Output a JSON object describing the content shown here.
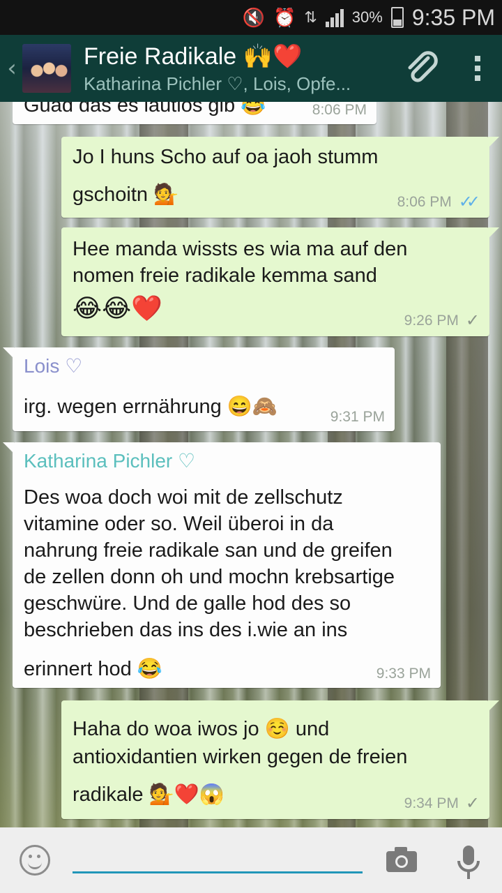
{
  "status_bar": {
    "battery_percent": "30%",
    "time": "9:35 PM",
    "icons": [
      "mute-icon",
      "alarm-icon",
      "data-arrows-icon",
      "signal-icon",
      "battery-icon"
    ]
  },
  "header": {
    "title": "Freie Radikale 🙌❤️",
    "subtitle": "Katharina Pichler ♡, Lois, Opfe...",
    "back_icon": "‹",
    "icons": [
      "back-icon",
      "group-avatar",
      "attach-icon",
      "overflow-menu-icon"
    ]
  },
  "messages": [
    {
      "direction": "in",
      "text": "Guad das es lautlos gib 😂",
      "time": "8:06 PM"
    },
    {
      "direction": "out",
      "line1": "Jo I huns Scho auf oa jaoh stumm",
      "line2": "gschoitn 💁",
      "time": "8:06 PM",
      "status": "read"
    },
    {
      "direction": "out",
      "line1": "Hee manda wissts es wia ma auf den",
      "line2": "nomen freie radikale kemma sand",
      "emojis": "😂😂❤️",
      "time": "9:26 PM",
      "status": "delivered"
    },
    {
      "direction": "in",
      "sender": "Lois ♡",
      "sender_color": "#8a90cc",
      "text": "irg. wegen errnährung 😄🙈",
      "time": "9:31 PM"
    },
    {
      "direction": "in",
      "sender": "Katharina Pichler ♡",
      "sender_color": "#5bbfbd",
      "lines": [
        "Des woa doch woi mit de zellschutz",
        "vitamine oder so. Weil überoi in da",
        "nahrung freie radikale san und de greifen",
        "de zellen donn oh und mochn krebsartige",
        "geschwüre. Und de galle hod des so",
        "beschrieben das ins des i.wie an ins",
        "erinnert hod 😂"
      ],
      "time": "9:33 PM"
    },
    {
      "direction": "out",
      "line1": "Haha do woa iwos jo ☺️ und",
      "line2": "antioxidantien wirken gegen de freien",
      "line3": "radikale 💁❤️😱",
      "time": "9:34 PM",
      "status": "delivered"
    }
  ],
  "input_bar": {
    "placeholder": "",
    "icons": [
      "emoji-icon",
      "camera-icon",
      "microphone-icon"
    ]
  },
  "colors": {
    "header_bg": "#0f3d38",
    "outgoing_bubble": "#e5f8cf",
    "incoming_bubble": "#fdfdfd",
    "read_tick": "#5fb0e8",
    "input_underline": "#2196b8"
  }
}
